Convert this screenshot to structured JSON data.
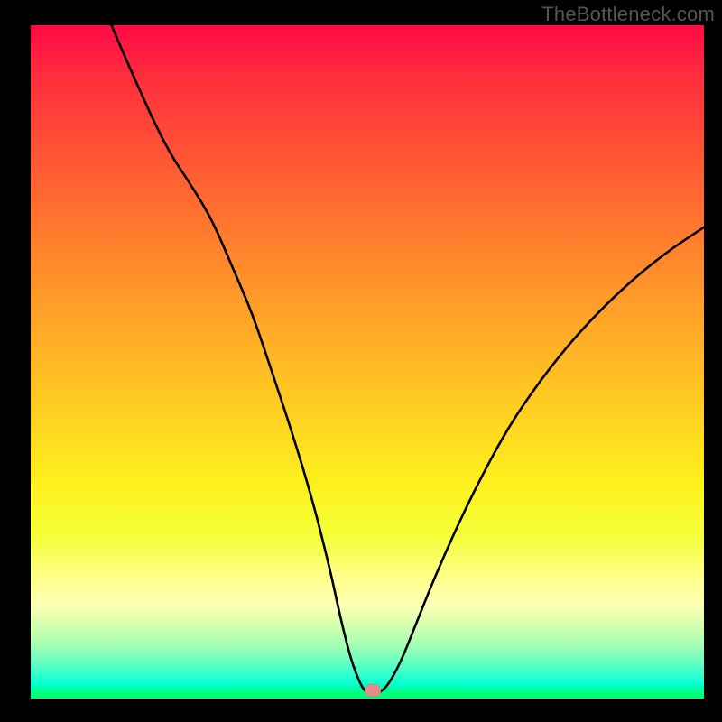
{
  "watermark": "TheBottleneck.com",
  "marker": {
    "x_pct": 50.8,
    "y_pct": 99.4
  },
  "chart_data": {
    "type": "line",
    "title": "",
    "xlabel": "",
    "ylabel": "",
    "xlim": [
      0,
      100
    ],
    "ylim": [
      0,
      100
    ],
    "grid": false,
    "legend": false,
    "comment": "V-shaped bottleneck curve over a red-to-green gradient. No axis tick labels are shown; values are estimated from pixel positions on a 0–100 normalized scale where y=0 is bottom, y=100 is top.",
    "series": [
      {
        "name": "bottleneck-curve",
        "x": [
          12.0,
          15.0,
          20.0,
          24.0,
          27.0,
          30.0,
          33.0,
          36.0,
          39.0,
          42.0,
          44.5,
          46.0,
          47.5,
          49.0,
          50.0,
          51.5,
          53.0,
          55.0,
          57.0,
          60.0,
          64.0,
          68.0,
          72.0,
          77.0,
          82.0,
          88.0,
          94.0,
          100.0
        ],
        "y": [
          100.0,
          93.0,
          82.0,
          76.0,
          71.0,
          64.0,
          57.0,
          48.0,
          39.0,
          29.0,
          19.0,
          12.0,
          6.0,
          2.0,
          0.7,
          0.7,
          1.8,
          5.5,
          10.5,
          18.0,
          27.0,
          35.0,
          42.0,
          49.0,
          55.0,
          61.0,
          66.0,
          70.0
        ]
      }
    ],
    "marker_point": {
      "x": 50.8,
      "y": 0.6
    }
  }
}
